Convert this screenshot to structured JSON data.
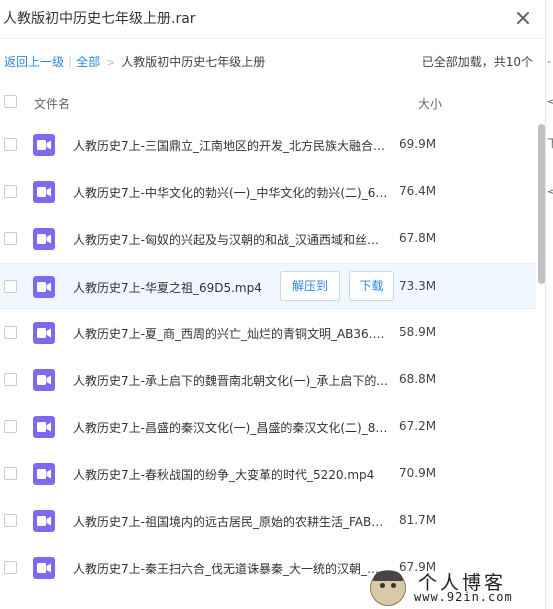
{
  "window": {
    "title": "人教版初中历史七年级上册.rar"
  },
  "breadcrumb": {
    "back_label": "返回上一级",
    "all_label": "全部",
    "current": "人教版初中历史七年级上册",
    "status": "已全部加载，共10个"
  },
  "columns": {
    "name": "文件名",
    "size": "大小"
  },
  "actions": {
    "extract_label": "解压到",
    "download_label": "下载"
  },
  "files": [
    {
      "name": "人教历史7上-三国鼎立_江南地区的开发_北方民族大融合_...",
      "size": "69.9M"
    },
    {
      "name": "人教历史7上-中华文化的勃兴(一)_中华文化的勃兴(二)_64...",
      "size": "76.4M"
    },
    {
      "name": "人教历史7上-匈奴的兴起及与汉朝的和战_汉通西域和丝绸...",
      "size": "67.8M"
    },
    {
      "name": "人教历史7上-华夏之祖_69D5.mp4",
      "size": "73.3M"
    },
    {
      "name": "人教历史7上-夏_商_西周的兴亡_灿烂的青铜文明_AB36.m...",
      "size": "58.9M"
    },
    {
      "name": "人教历史7上-承上启下的魏晋南北朝文化(一)_承上启下的...",
      "size": "68.8M"
    },
    {
      "name": "人教历史7上-昌盛的秦汉文化(一)_昌盛的秦汉文化(二)_8C...",
      "size": "67.2M"
    },
    {
      "name": "人教历史7上-春秋战国的纷争_大变革的时代_5220.mp4",
      "size": "70.9M"
    },
    {
      "name": "人教历史7上-祖国境内的远古居民_原始的农耕生活_FAB9...",
      "size": "81.7M"
    },
    {
      "name": "人教历史7上-秦王扫六合_伐无道诛暴秦_大一统的汉朝_西...",
      "size": "67.9M"
    }
  ],
  "side_strip": [
    "-",
    "<",
    "下",
    "<"
  ],
  "watermark": {
    "line1": "个人博客",
    "line2": "www.92in.com"
  },
  "colors": {
    "accent": "#2a88e8",
    "file_icon": "#7c6bf0",
    "highlight": "#f1f7fe"
  }
}
